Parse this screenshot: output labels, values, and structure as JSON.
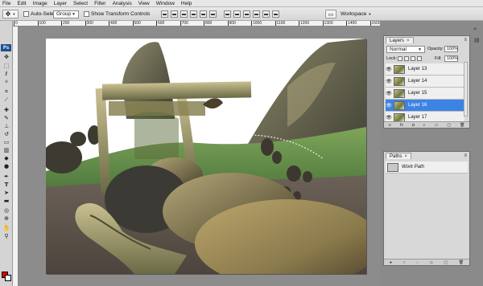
{
  "menubar": {
    "items": [
      "File",
      "Edit",
      "Image",
      "Layer",
      "Select",
      "Filter",
      "Analysis",
      "View",
      "Window",
      "Help"
    ]
  },
  "options_bar": {
    "auto_select_label": "Auto-Select:",
    "auto_select_value": "Group",
    "transform_label": "Show Transform Controls",
    "workspace_label": "Workspace"
  },
  "tools": {
    "logo": "Ps"
  },
  "rulers": {
    "top_ticks": [
      "0",
      "100",
      "200",
      "300",
      "400",
      "500",
      "600",
      "700",
      "800",
      "900",
      "1000",
      "1100",
      "1200",
      "1300",
      "1400",
      "1500"
    ]
  },
  "layers_panel": {
    "tab_label": "Layers",
    "blend_mode": "Normal",
    "opacity_label": "Opacity:",
    "opacity_value": "100%",
    "lock_label": "Lock:",
    "fill_label": "Fill:",
    "fill_value": "100%",
    "layers": [
      {
        "name": "Layer 13",
        "selected": false
      },
      {
        "name": "Layer 14",
        "selected": false
      },
      {
        "name": "Layer 15",
        "selected": false
      },
      {
        "name": "Layer 16",
        "selected": true
      },
      {
        "name": "Layer 17",
        "selected": false
      }
    ]
  },
  "paths_panel": {
    "tab_label": "Paths",
    "paths": [
      {
        "name": "Work Path"
      }
    ]
  },
  "colors": {
    "foreground": "#e00000",
    "background": "#ffffff",
    "selection": "#3d83e4"
  }
}
